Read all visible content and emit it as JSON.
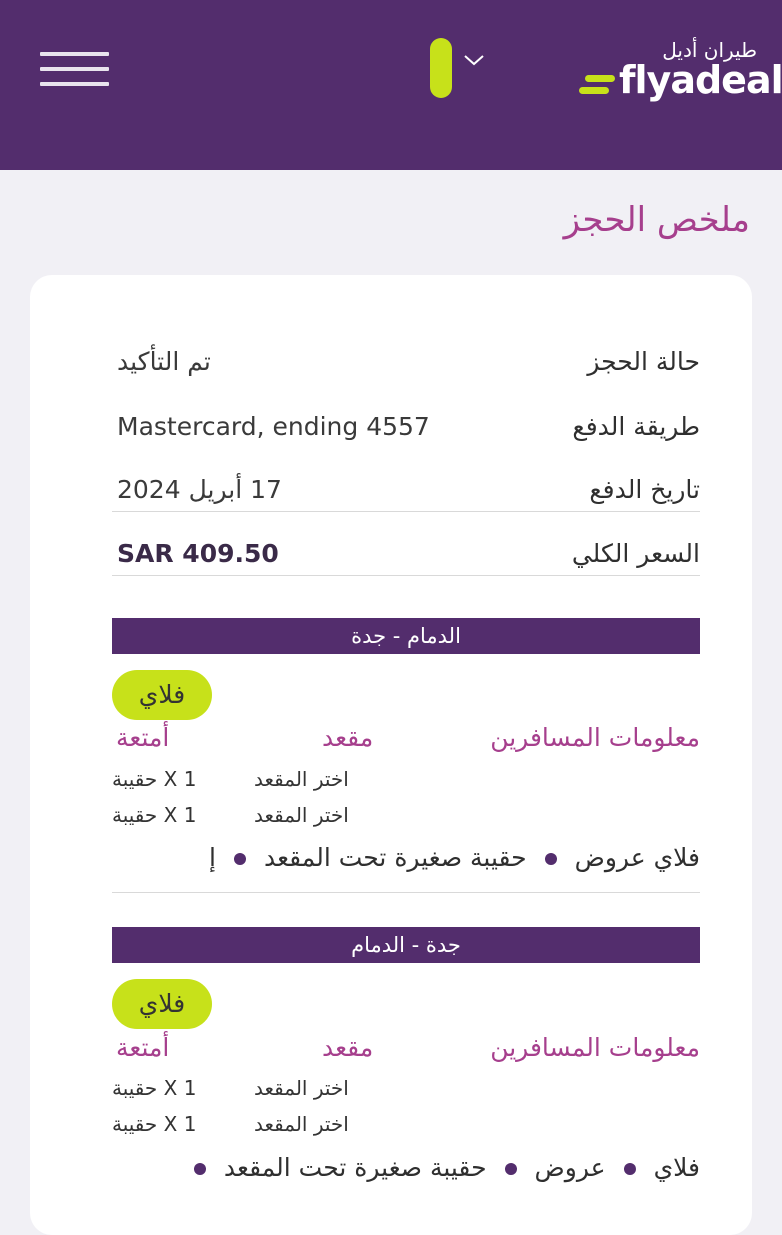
{
  "header": {
    "logo_ar": "طيران أديل",
    "logo_en": "flyadeal",
    "colors": {
      "brand_purple": "#532d6d",
      "accent_lime": "#c7e11a",
      "title_magenta": "#a63f8d"
    },
    "icons": [
      "menu-icon",
      "chevron-down-icon"
    ]
  },
  "page": {
    "title": "ملخص الحجز"
  },
  "summary": {
    "booking_status_label": "حالة الحجز",
    "booking_status_value": "تم التأكيد",
    "payment_method_label": "طريقة الدفع",
    "payment_method_value": "Mastercard, ending 4557",
    "payment_date_label": "تاريخ الدفع",
    "payment_date_value": "17 أبريل 2024",
    "total_price_label": "السعر الكلي",
    "total_price_value": "SAR 409.50"
  },
  "flights": [
    {
      "route": "الدمام  -  جدة",
      "fare": "فلاي",
      "col_passengers": "معلومات المسافرين",
      "col_seat": "مقعد",
      "col_baggage": "أمتعة",
      "rows": [
        {
          "seat": "اختر المقعد",
          "baggage": "1 X حقيبة"
        },
        {
          "seat": "اختر المقعد",
          "baggage": "1 X حقيبة"
        }
      ],
      "bundle": [
        "فلاي  عروض",
        "حقيبة صغيرة تحت المقعد",
        "إ"
      ]
    },
    {
      "route": "جدة  -  الدمام",
      "fare": "فلاي",
      "col_passengers": "معلومات المسافرين",
      "col_seat": "مقعد",
      "col_baggage": "أمتعة",
      "rows": [
        {
          "seat": "اختر المقعد",
          "baggage": "1 X حقيبة"
        },
        {
          "seat": "اختر المقعد",
          "baggage": "1 X حقيبة"
        }
      ],
      "bundle": [
        "فلاي",
        "عروض",
        "حقيبة صغيرة تحت المقعد"
      ]
    }
  ]
}
